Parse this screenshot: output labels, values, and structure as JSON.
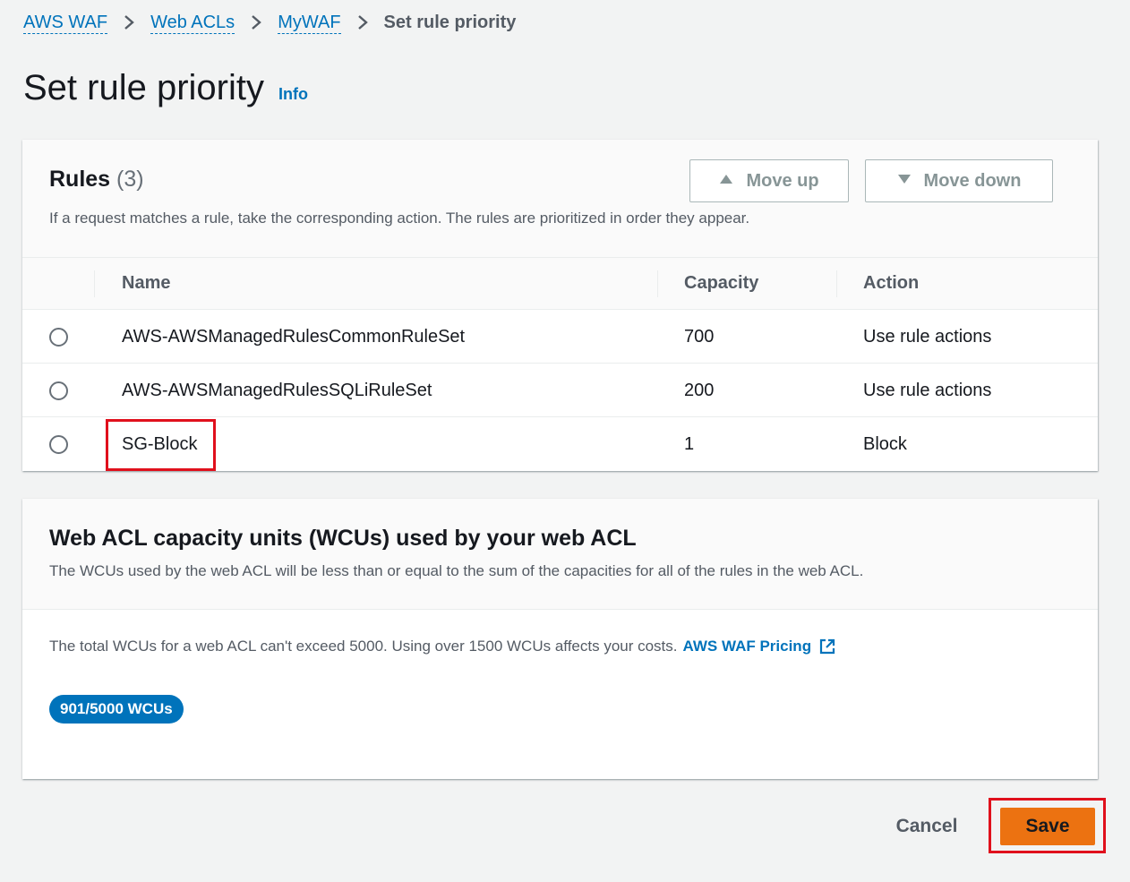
{
  "breadcrumb": {
    "items": [
      "AWS WAF",
      "Web ACLs",
      "MyWAF"
    ],
    "current": "Set rule priority"
  },
  "page": {
    "title": "Set rule priority",
    "info_label": "Info"
  },
  "rules": {
    "title": "Rules",
    "count": "(3)",
    "description": "If a request matches a rule, take the corresponding action. The rules are prioritized in order they appear.",
    "move_up_label": "Move up",
    "move_down_label": "Move down",
    "columns": [
      "Name",
      "Capacity",
      "Action"
    ],
    "rows": [
      {
        "name": "AWS-AWSManagedRulesCommonRuleSet",
        "capacity": "700",
        "action": "Use rule actions"
      },
      {
        "name": "AWS-AWSManagedRulesSQLiRuleSet",
        "capacity": "200",
        "action": "Use rule actions"
      },
      {
        "name": "SG-Block",
        "capacity": "1",
        "action": "Block"
      }
    ]
  },
  "wcu": {
    "title": "Web ACL capacity units (WCUs) used by your web ACL",
    "description": "The WCUs used by the web ACL will be less than or equal to the sum of the capacities for all of the rules in the web ACL.",
    "total_text": "The total WCUs for a web ACL can't exceed 5000. Using over 1500 WCUs affects your costs.",
    "pricing_link": "AWS WAF Pricing",
    "badge": "901/5000 WCUs"
  },
  "footer": {
    "cancel_label": "Cancel",
    "save_label": "Save"
  },
  "colors": {
    "link": "#0073bb",
    "primary_button": "#ec7211",
    "highlight": "#e0101c",
    "badge": "#0073bb"
  },
  "icons": {
    "breadcrumb_separator": "chevron-right-icon",
    "move_up": "caret-up-icon",
    "move_down": "caret-down-icon",
    "external_link": "external-link-icon"
  }
}
